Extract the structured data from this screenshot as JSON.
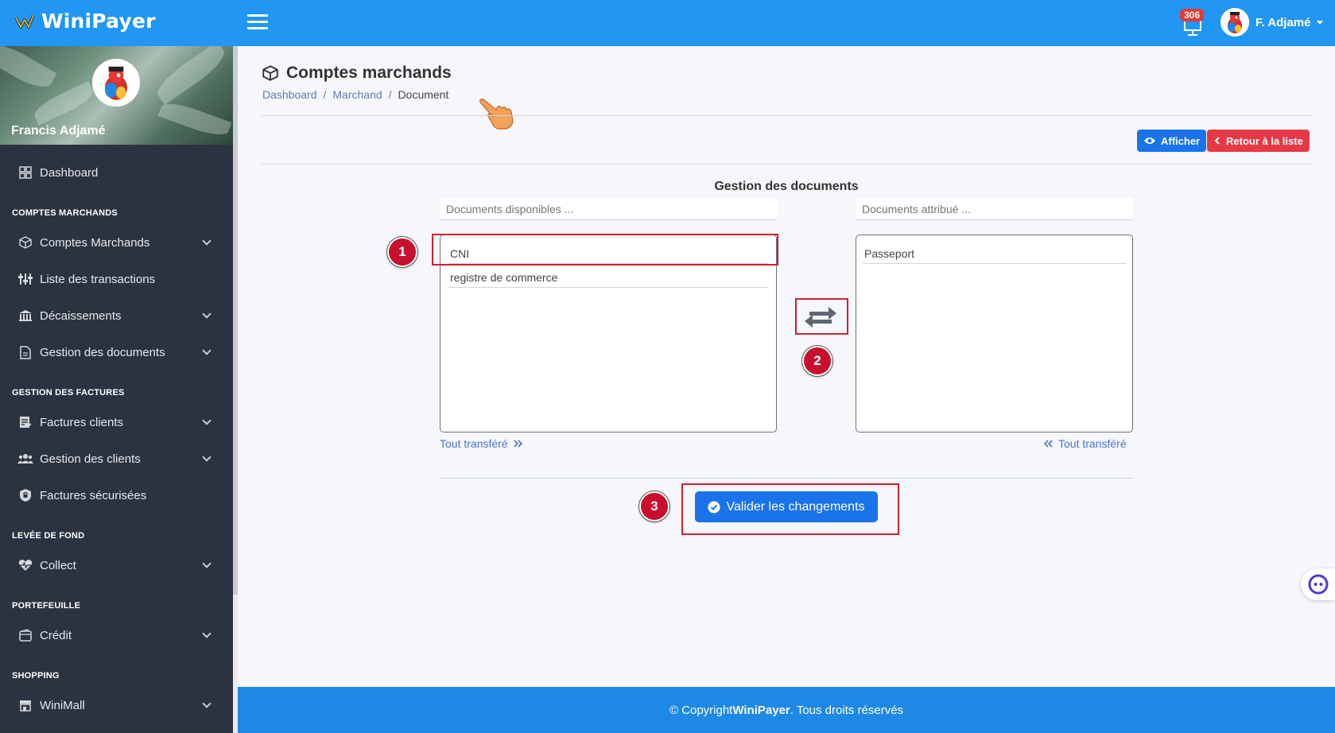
{
  "app": {
    "brand_name": "WiniPayer",
    "notification_count": "306",
    "user_short_name": "F. Adjamé"
  },
  "sidebar": {
    "profile_name": "Francis Adjamé",
    "dashboard_label": "Dashboard",
    "sections": {
      "comptes": "COMPTES MARCHANDS",
      "factures": "GESTION DES FACTURES",
      "levee": "LEVÉE DE FOND",
      "portefeuille": "PORTEFEUILLE",
      "shopping": "SHOPPING"
    },
    "items": {
      "comptes_marchands": "Comptes Marchands",
      "liste_transactions": "Liste des transactions",
      "decaissements": "Décaissements",
      "gestion_documents": "Gestion des documents",
      "factures_clients": "Factures clients",
      "gestion_clients": "Gestion des clients",
      "factures_securisees": "Factures sécurisées",
      "collect": "Collect",
      "credit": "Crédit",
      "winimall": "WiniMall"
    }
  },
  "page": {
    "title": "Comptes marchands",
    "breadcrumb": [
      "Dashboard",
      "Marchand",
      "Document"
    ],
    "afficher_label": "Afficher",
    "retour_label": "Retour à la liste"
  },
  "documents": {
    "section_title": "Gestion des documents",
    "available_placeholder": "Documents disponibles ...",
    "assigned_placeholder": "Documents attribué ...",
    "available": [
      "CNI",
      "registre de commerce"
    ],
    "assigned": [
      "Passeport"
    ],
    "transfer_all_right": "Tout transféré",
    "transfer_all_left": "Tout transféré",
    "validate_label": "Valider les changements"
  },
  "markers": [
    "1",
    "2",
    "3"
  ],
  "footer": {
    "prefix": "© Copyright ",
    "brand": "WiniPayer",
    "suffix": ". Tous droits réservés"
  },
  "colors": {
    "topbar": "#2196f3",
    "sidebar": "#2c3340",
    "primary_button": "#1a73e8",
    "danger_button": "#e53945",
    "highlight": "#d0202e",
    "footer": "#1e88e5"
  }
}
